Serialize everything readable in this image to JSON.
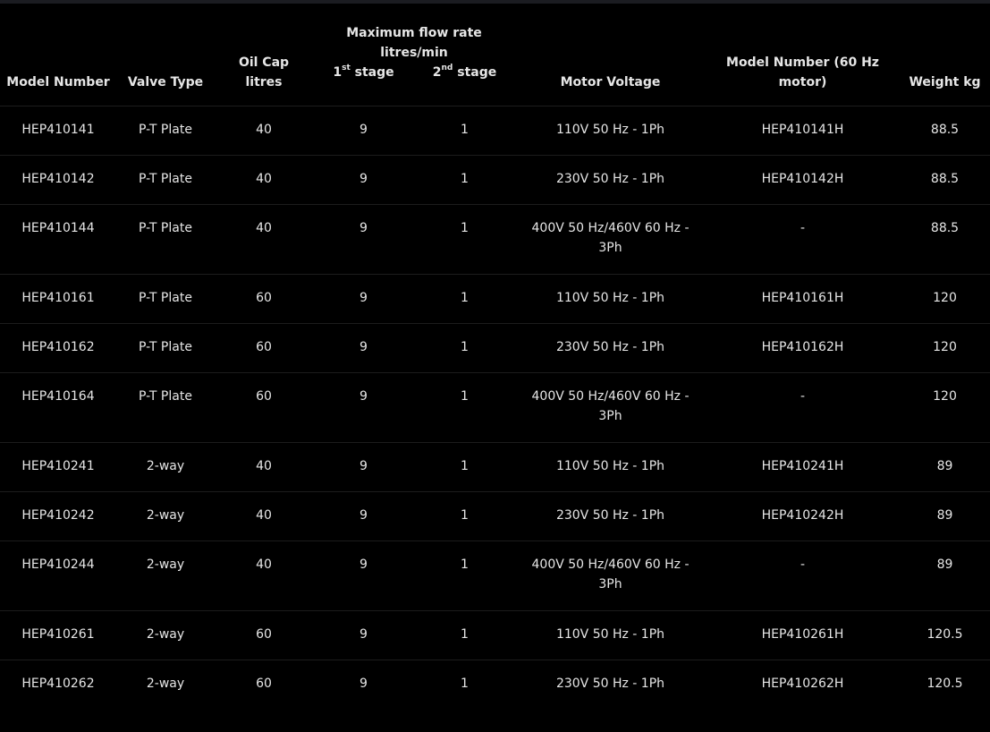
{
  "header": {
    "model_number": "Model Number",
    "valve_type": "Valve Type",
    "oil_cap": "Oil Cap litres",
    "flow_group": "Maximum flow rate litres/min",
    "stage1_num": "1",
    "stage1_sup": "st",
    "stage1_label": " stage",
    "stage2_num": "2",
    "stage2_sup": "nd",
    "stage2_label": " stage",
    "motor_voltage": "Motor Voltage",
    "model_60hz": "Model Number (60 Hz motor)",
    "weight": "Weight kg"
  },
  "rows": [
    {
      "model": "HEP410141",
      "valve": "P-T Plate",
      "oil": "40",
      "s1": "9",
      "s2": "1",
      "motor": "110V 50 Hz - 1Ph",
      "model60": "HEP410141H",
      "weight": "88.5"
    },
    {
      "model": "HEP410142",
      "valve": "P-T Plate",
      "oil": "40",
      "s1": "9",
      "s2": "1",
      "motor": "230V 50 Hz - 1Ph",
      "model60": "HEP410142H",
      "weight": "88.5"
    },
    {
      "model": "HEP410144",
      "valve": "P-T Plate",
      "oil": "40",
      "s1": "9",
      "s2": "1",
      "motor": "400V 50 Hz/460V 60 Hz - 3Ph",
      "model60": "-",
      "weight": "88.5"
    },
    {
      "model": "HEP410161",
      "valve": "P-T Plate",
      "oil": "60",
      "s1": "9",
      "s2": "1",
      "motor": "110V 50 Hz - 1Ph",
      "model60": "HEP410161H",
      "weight": "120"
    },
    {
      "model": "HEP410162",
      "valve": "P-T Plate",
      "oil": "60",
      "s1": "9",
      "s2": "1",
      "motor": "230V 50 Hz - 1Ph",
      "model60": "HEP410162H",
      "weight": "120"
    },
    {
      "model": "HEP410164",
      "valve": "P-T Plate",
      "oil": "60",
      "s1": "9",
      "s2": "1",
      "motor": "400V 50 Hz/460V 60 Hz - 3Ph",
      "model60": "-",
      "weight": "120"
    },
    {
      "model": "HEP410241",
      "valve": "2-way",
      "oil": "40",
      "s1": "9",
      "s2": "1",
      "motor": "110V 50 Hz - 1Ph",
      "model60": "HEP410241H",
      "weight": "89"
    },
    {
      "model": "HEP410242",
      "valve": "2-way",
      "oil": "40",
      "s1": "9",
      "s2": "1",
      "motor": "230V 50 Hz - 1Ph",
      "model60": "HEP410242H",
      "weight": "89"
    },
    {
      "model": "HEP410244",
      "valve": "2-way",
      "oil": "40",
      "s1": "9",
      "s2": "1",
      "motor": "400V 50 Hz/460V 60 Hz - 3Ph",
      "model60": "-",
      "weight": "89"
    },
    {
      "model": "HEP410261",
      "valve": "2-way",
      "oil": "60",
      "s1": "9",
      "s2": "1",
      "motor": "110V 50 Hz - 1Ph",
      "model60": "HEP410261H",
      "weight": "120.5"
    },
    {
      "model": "HEP410262",
      "valve": "2-way",
      "oil": "60",
      "s1": "9",
      "s2": "1",
      "motor": "230V 50 Hz - 1Ph",
      "model60": "HEP410262H",
      "weight": "120.5"
    }
  ],
  "colors": {
    "background": "#000000",
    "text": "#e6e6e6",
    "row_divider": "#1c1c1c",
    "top_bar": "#1b1c21"
  }
}
